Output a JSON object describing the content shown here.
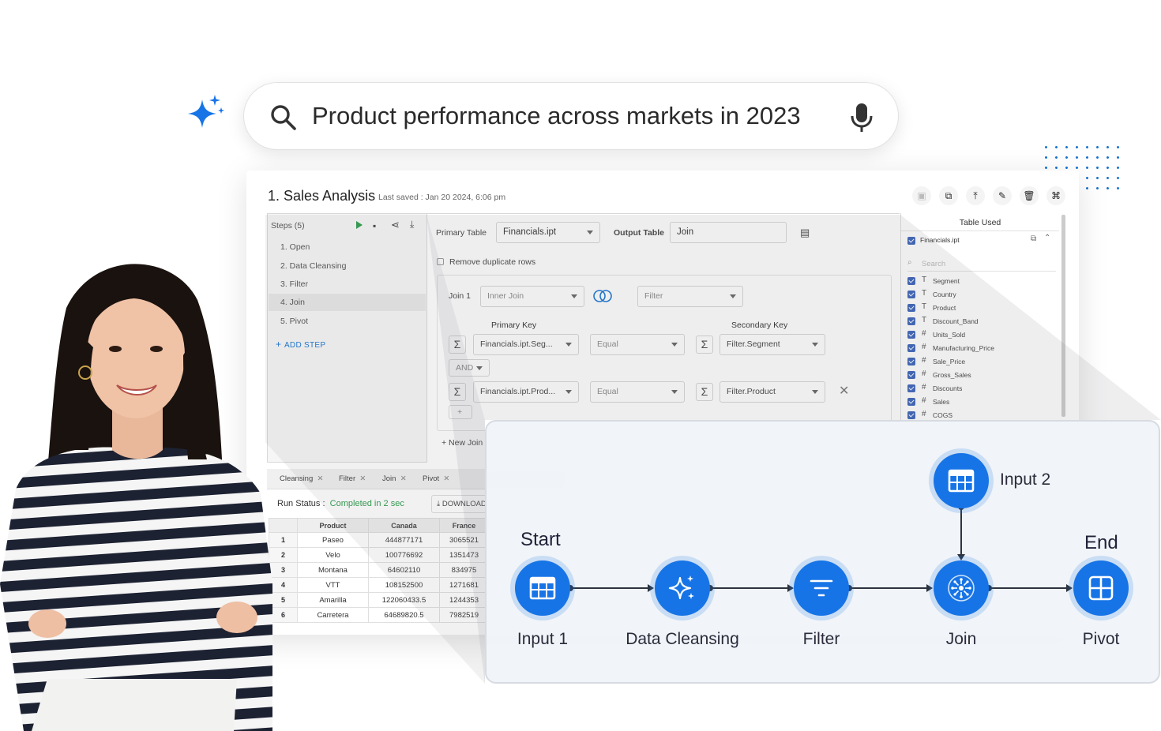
{
  "search": {
    "query": "Product performance across markets in 2023"
  },
  "app": {
    "title": "1. Sales Analysis",
    "last_saved": "Last saved : Jan 20 2024, 6:06 pm",
    "steps": {
      "header": "Steps (5)",
      "items": [
        "1. Open",
        "2. Data Cleansing",
        "3. Filter",
        "4. Join",
        "5. Pivot"
      ],
      "add_step": "ADD STEP"
    },
    "config": {
      "primary_table_label": "Primary Table",
      "primary_table_value": "Financials.ipt",
      "output_table_label": "Output Table",
      "output_table_value": "Join",
      "remove_duplicates": "Remove duplicate rows",
      "join_label": "Join 1",
      "join_type": "Inner Join",
      "join_with": "Filter",
      "primary_key_label": "Primary Key",
      "secondary_key_label": "Secondary Key",
      "keys": [
        {
          "primary": "Financials.ipt.Seg...",
          "op": "Equal",
          "secondary": "Filter.Segment"
        },
        {
          "primary": "Financials.ipt.Prod...",
          "op": "Equal",
          "secondary": "Filter.Product"
        }
      ],
      "and_label": "AND",
      "plus": "+",
      "new_join": "+ New Join"
    },
    "table_used": {
      "title": "Table Used",
      "table": "Financials.ipt",
      "search_placeholder": "Search",
      "columns": [
        {
          "type": "T",
          "name": "Segment"
        },
        {
          "type": "T",
          "name": "Country"
        },
        {
          "type": "T",
          "name": "Product"
        },
        {
          "type": "T",
          "name": "Discount_Band"
        },
        {
          "type": "#",
          "name": "Units_Sold"
        },
        {
          "type": "#",
          "name": "Manufacturing_Price"
        },
        {
          "type": "#",
          "name": "Sale_Price"
        },
        {
          "type": "#",
          "name": "Gross_Sales"
        },
        {
          "type": "#",
          "name": "Discounts"
        },
        {
          "type": "#",
          "name": "Sales"
        },
        {
          "type": "#",
          "name": "COGS"
        }
      ]
    },
    "tabs": [
      "Cleansing",
      "Filter",
      "Join",
      "Pivot"
    ],
    "run_status_label": "Run Status :",
    "run_status_value": "Completed in 2 sec",
    "download": "DOWNLOAD",
    "grid": {
      "headers": [
        "",
        "Product",
        "Canada",
        "France"
      ],
      "rows": [
        [
          "1",
          "Paseo",
          "444877171",
          "3065521"
        ],
        [
          "2",
          "Velo",
          "100776692",
          "1351473"
        ],
        [
          "3",
          "Montana",
          "64602110",
          "834975"
        ],
        [
          "4",
          "VTT",
          "108152500",
          "1271681"
        ],
        [
          "5",
          "Amarilla",
          "122060433.5",
          "1244353"
        ],
        [
          "6",
          "Carretera",
          "64689820.5",
          "7982519"
        ]
      ]
    }
  },
  "flow": {
    "start_label": "Start",
    "end_label": "End",
    "nodes": [
      {
        "id": "input1",
        "label": "Input 1",
        "icon": "table-icon"
      },
      {
        "id": "cleansing",
        "label": "Data Cleansing",
        "icon": "sparkle-icon"
      },
      {
        "id": "filter",
        "label": "Filter",
        "icon": "filter-icon"
      },
      {
        "id": "join",
        "label": "Join",
        "icon": "join-icon"
      },
      {
        "id": "pivot",
        "label": "Pivot",
        "icon": "pivot-icon"
      },
      {
        "id": "input2",
        "label": "Input 2",
        "icon": "table-icon"
      }
    ]
  },
  "colors": {
    "accent": "#1774e6",
    "link": "#1976d2",
    "success": "#2e9e4b",
    "checkbox": "#3b63b8"
  }
}
